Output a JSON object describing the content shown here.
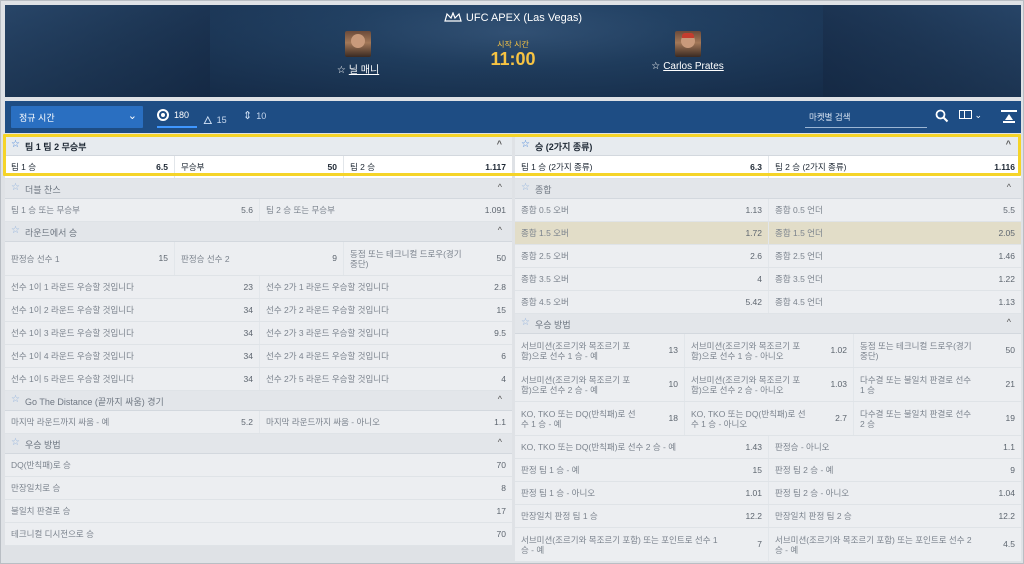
{
  "event": {
    "title": "UFC APEX (Las Vegas)",
    "kick_label": "시작 시간",
    "kick_time": "11:00",
    "fighter1": "닐 매니",
    "fighter2": "Carlos Prates"
  },
  "toolbar": {
    "period": "정규 시간",
    "count_all": "180",
    "count_live": "15",
    "count_sort": "10",
    "search_placeholder": "마켓별 검색"
  },
  "left_markets": [
    {
      "title": "팀 1 팀 2 무승부",
      "active": true,
      "rows": [
        {
          "cells": [
            {
              "label": "팀 1 승",
              "odd": "6.5"
            },
            {
              "label": "무승부",
              "odd": "50"
            },
            {
              "label": "팀 2 승",
              "odd": "1.117"
            }
          ]
        }
      ]
    },
    {
      "title": "더블 찬스",
      "rows": [
        {
          "cells": [
            {
              "label": "팀 1 승 또는 무승부",
              "odd": "5.6"
            },
            {
              "label": "팀 2 승 또는 무승부",
              "odd": "1.091"
            }
          ]
        }
      ]
    },
    {
      "title": "라운드에서 승",
      "rows": [
        {
          "tall": true,
          "cells": [
            {
              "label": "판정승 선수 1",
              "odd": "15"
            },
            {
              "label": "판정승 선수 2",
              "odd": "9"
            },
            {
              "label": "동점 또는 테크니컬 드로우(경기 중단)",
              "odd": "50"
            }
          ]
        },
        {
          "cells": [
            {
              "label": "선수 1이 1 라운드 우승할 것입니다",
              "odd": "23"
            },
            {
              "label": "선수 2가 1 라운드 우승할 것입니다",
              "odd": "2.8"
            }
          ]
        },
        {
          "cells": [
            {
              "label": "선수 1이 2 라운드 우승할 것입니다",
              "odd": "34"
            },
            {
              "label": "선수 2가 2 라운드 우승할 것입니다",
              "odd": "15"
            }
          ]
        },
        {
          "cells": [
            {
              "label": "선수 1이 3 라운드 우승할 것입니다",
              "odd": "34"
            },
            {
              "label": "선수 2가 3 라운드 우승할 것입니다",
              "odd": "9.5"
            }
          ]
        },
        {
          "cells": [
            {
              "label": "선수 1이 4 라운드 우승할 것입니다",
              "odd": "34"
            },
            {
              "label": "선수 2가 4 라운드 우승할 것입니다",
              "odd": "6"
            }
          ]
        },
        {
          "cells": [
            {
              "label": "선수 1이 5 라운드 우승할 것입니다",
              "odd": "34"
            },
            {
              "label": "선수 2가 5 라운드 우승할 것입니다",
              "odd": "4"
            }
          ]
        }
      ]
    },
    {
      "title": "Go The Distance (끝까지 싸움) 경기",
      "rows": [
        {
          "cells": [
            {
              "label": "마지막 라운드까지 싸움 - 예",
              "odd": "5.2"
            },
            {
              "label": "마지막 라운드까지 싸움 - 아니오",
              "odd": "1.1"
            }
          ]
        }
      ]
    },
    {
      "title": "우승 방법",
      "rows": [
        {
          "cells": [
            {
              "label": "DQ(반칙패)로 승",
              "odd": "70"
            }
          ]
        },
        {
          "cells": [
            {
              "label": "만장일치로 승",
              "odd": "8"
            }
          ]
        },
        {
          "cells": [
            {
              "label": "불일치 판결로 승",
              "odd": "17"
            }
          ]
        },
        {
          "cells": [
            {
              "label": "테크니컬 디시전으로 승",
              "odd": "70"
            }
          ]
        }
      ]
    }
  ],
  "right_markets": [
    {
      "title": "승 (2가지 종류)",
      "active": true,
      "rows": [
        {
          "cells": [
            {
              "label": "팀 1 승 (2가지 종류)",
              "odd": "6.3"
            },
            {
              "label": "팀 2 승 (2가지 종류)",
              "odd": "1.116"
            }
          ]
        }
      ]
    },
    {
      "title": "종합",
      "rows": [
        {
          "cells": [
            {
              "label": "종합 0.5 오버",
              "odd": "1.13"
            },
            {
              "label": "종합 0.5 언더",
              "odd": "5.5"
            }
          ]
        },
        {
          "hl": true,
          "cells": [
            {
              "label": "종합 1.5 오버",
              "odd": "1.72"
            },
            {
              "label": "종합 1.5 언더",
              "odd": "2.05"
            }
          ]
        },
        {
          "cells": [
            {
              "label": "종합 2.5 오버",
              "odd": "2.6"
            },
            {
              "label": "종합 2.5 언더",
              "odd": "1.46"
            }
          ]
        },
        {
          "cells": [
            {
              "label": "종합 3.5 오버",
              "odd": "4"
            },
            {
              "label": "종합 3.5 언더",
              "odd": "1.22"
            }
          ]
        },
        {
          "cells": [
            {
              "label": "종합 4.5 오버",
              "odd": "5.42"
            },
            {
              "label": "종합 4.5 언더",
              "odd": "1.13"
            }
          ]
        }
      ]
    },
    {
      "title": "우승 방법",
      "rows": [
        {
          "tall": true,
          "cells": [
            {
              "label": "서브미션(조르기와 목조르기 포함)으로 선수 1 승 - 예",
              "odd": "13"
            },
            {
              "label": "서브미션(조르기와 목조르기 포함)으로 선수 1 승 - 아니오",
              "odd": "1.02"
            },
            {
              "label": "동점 또는 테크니컬 드로우(경기 중단)",
              "odd": "50"
            }
          ]
        },
        {
          "tall": true,
          "cells": [
            {
              "label": "서브미션(조르기와 목조르기 포함)으로 선수 2 승 - 예",
              "odd": "10"
            },
            {
              "label": "서브미션(조르기와 목조르기 포함)으로 선수 2 승 - 아니오",
              "odd": "1.03"
            },
            {
              "label": "다수결 또는 불일치 판결로 선수 1 승",
              "odd": "21"
            }
          ]
        },
        {
          "tall": true,
          "cells": [
            {
              "label": "KO, TKO 또는 DQ(반칙패)로 선수 1 승 - 예",
              "odd": "18"
            },
            {
              "label": "KO, TKO 또는 DQ(반칙패)로 선수 1 승 - 아니오",
              "odd": "2.7"
            },
            {
              "label": "다수결 또는 불일치 판결로 선수 2 승",
              "odd": "19"
            }
          ]
        },
        {
          "cells": [
            {
              "label": "KO, TKO 또는 DQ(반칙패)로 선수 2 승 - 예",
              "odd": "1.43"
            },
            {
              "label": "판정승 - 아니오",
              "odd": "1.1"
            }
          ]
        },
        {
          "cells": [
            {
              "label": "판정 팀 1 승 - 예",
              "odd": "15"
            },
            {
              "label": "판정 팀 2 승 - 예",
              "odd": "9"
            }
          ]
        },
        {
          "cells": [
            {
              "label": "판정 팀 1 승 - 아니오",
              "odd": "1.01"
            },
            {
              "label": "판정 팀 2 승 - 아니오",
              "odd": "1.04"
            }
          ]
        },
        {
          "cells": [
            {
              "label": "만장일치 판정 팀 1 승",
              "odd": "12.2"
            },
            {
              "label": "만장일치 판정 팀 2 승",
              "odd": "12.2"
            }
          ]
        },
        {
          "tall": true,
          "cells": [
            {
              "label": "서브미션(조르기와 목조르기 포함) 또는 포인트로 선수 1 승 - 예",
              "odd": "7"
            },
            {
              "label": "서브미션(조르기와 목조르기 포함) 또는 포인트로 선수 2 승 - 예",
              "odd": "4.5"
            }
          ]
        }
      ]
    }
  ]
}
